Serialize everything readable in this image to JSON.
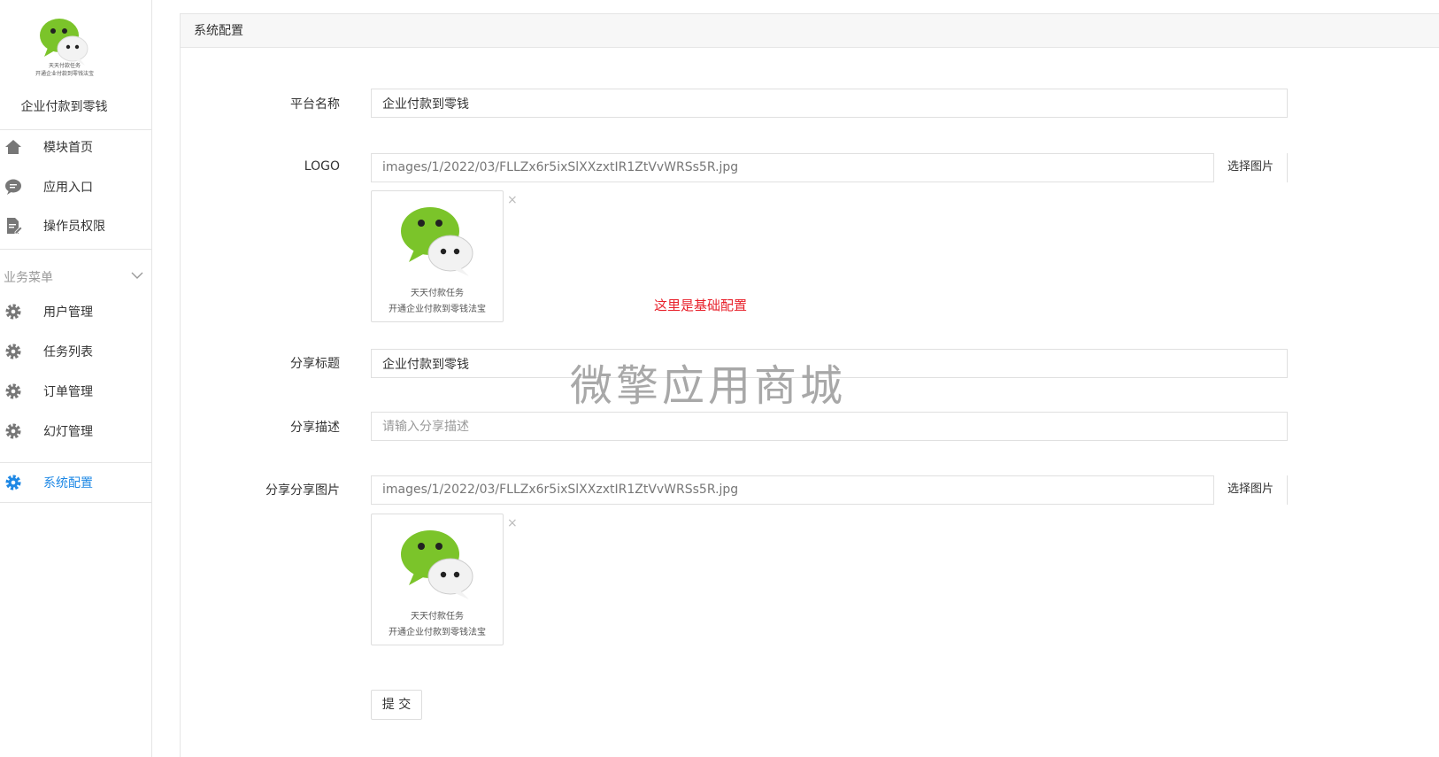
{
  "brand": {
    "logo_caption_1": "天天付款任务",
    "logo_caption_2": "开通企业付款到零钱法宝",
    "name": "企业付款到零钱"
  },
  "nav": {
    "top_items": [
      {
        "label": "模块首页",
        "icon": "home-icon"
      },
      {
        "label": "应用入口",
        "icon": "chat-icon"
      },
      {
        "label": "操作员权限",
        "icon": "edit-doc-icon"
      }
    ],
    "group_label": "业务菜单",
    "group_items": [
      {
        "label": "用户管理",
        "icon": "gear-icon"
      },
      {
        "label": "任务列表",
        "icon": "gear-icon"
      },
      {
        "label": "订单管理",
        "icon": "gear-icon"
      },
      {
        "label": "幻灯管理",
        "icon": "gear-icon"
      },
      {
        "label": "系统配置",
        "icon": "gear-icon",
        "active": true
      }
    ]
  },
  "panel": {
    "title": "系统配置",
    "platform_name_label": "平台名称",
    "platform_name_value": "企业付款到零钱",
    "logo_label": "LOGO",
    "logo_path": "images/1/2022/03/FLLZx6r5ixSlXXzxtIR1ZtVvWRSs5R.jpg",
    "pick_image": "选择图片",
    "thumb_caption_1": "天天付款任务",
    "thumb_caption_2": "开通企业付款到零钱法宝",
    "note": "这里是基础配置",
    "share_title_label": "分享标题",
    "share_title_value": "企业付款到零钱",
    "share_desc_label": "分享描述",
    "share_desc_placeholder": "请输入分享描述",
    "share_image_label": "分享分享图片",
    "share_image_path": "images/1/2022/03/FLLZx6r5ixSlXXzxtIR1ZtVvWRSs5R.jpg",
    "submit": "提 交",
    "close_mark": "×"
  },
  "watermark": "微擎应用商城",
  "colors": {
    "accent": "#1e88e5",
    "note": "#e8202a",
    "wechat_green": "#7bc42a"
  }
}
